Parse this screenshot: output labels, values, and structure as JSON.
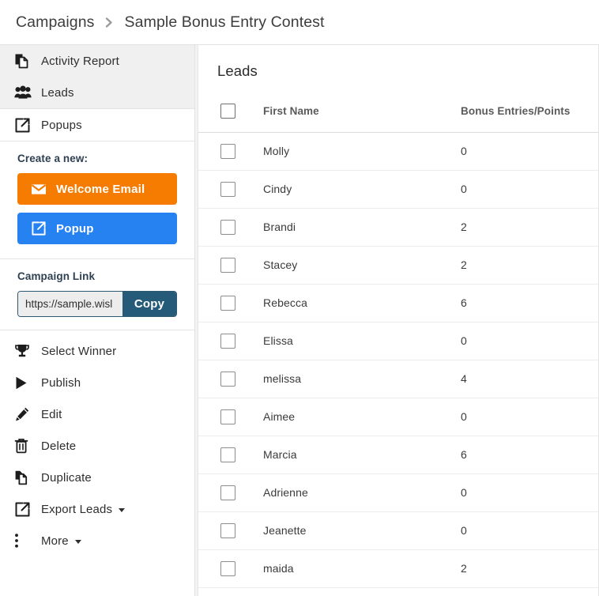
{
  "breadcrumb": {
    "root": "Campaigns",
    "separator_icon": "chevron-right-icon",
    "current": "Sample Bonus Entry Contest"
  },
  "sidebar": {
    "nav_highlighted": [
      {
        "label": "Activity Report",
        "icon": "copy-pages-icon",
        "active": true
      },
      {
        "label": "Leads",
        "icon": "users-group-icon",
        "active": true
      }
    ],
    "nav_plain": [
      {
        "label": "Popups",
        "icon": "external-link-icon",
        "active": false
      }
    ],
    "create": {
      "title": "Create a new:",
      "buttons": [
        {
          "label": "Welcome Email",
          "icon": "envelope-icon",
          "color": "#f57c00"
        },
        {
          "label": "Popup",
          "icon": "external-link-icon",
          "color": "#2682f0"
        }
      ]
    },
    "campaign_link": {
      "title": "Campaign Link",
      "input_value": "https://sample.wisl",
      "input_placeholder": "https://",
      "copy_label": "Copy",
      "copy_color": "#255a78"
    },
    "actions": [
      {
        "label": "Select Winner",
        "icon": "trophy-icon",
        "has_caret": false
      },
      {
        "label": "Publish",
        "icon": "play-triangle-icon",
        "has_caret": false
      },
      {
        "label": "Edit",
        "icon": "pencil-icon",
        "has_caret": false
      },
      {
        "label": "Delete",
        "icon": "trash-icon",
        "has_caret": false
      },
      {
        "label": "Duplicate",
        "icon": "duplicate-pages-icon",
        "has_caret": false
      },
      {
        "label": "Export Leads",
        "icon": "external-link-icon",
        "has_caret": true
      },
      {
        "label": "More",
        "icon": "kebab-menu-icon",
        "has_caret": true
      }
    ]
  },
  "main": {
    "title": "Leads",
    "table": {
      "select_all_checked": false,
      "columns": [
        "",
        "First Name",
        "Bonus Entries/Points"
      ],
      "rows": [
        {
          "checked": false,
          "first_name": "Molly",
          "points": "0"
        },
        {
          "checked": false,
          "first_name": "Cindy",
          "points": "0"
        },
        {
          "checked": false,
          "first_name": "Brandi",
          "points": "2"
        },
        {
          "checked": false,
          "first_name": "Stacey",
          "points": "2"
        },
        {
          "checked": false,
          "first_name": "Rebecca",
          "points": "6"
        },
        {
          "checked": false,
          "first_name": "Elissa",
          "points": "0"
        },
        {
          "checked": false,
          "first_name": "melissa",
          "points": "4"
        },
        {
          "checked": false,
          "first_name": "Aimee",
          "points": "0"
        },
        {
          "checked": false,
          "first_name": "Marcia",
          "points": "6"
        },
        {
          "checked": false,
          "first_name": "Adrienne",
          "points": "0"
        },
        {
          "checked": false,
          "first_name": "Jeanette",
          "points": "0"
        },
        {
          "checked": false,
          "first_name": "maida",
          "points": "2"
        }
      ]
    }
  },
  "colors": {
    "accent_orange": "#f57c00",
    "accent_blue": "#2682f0",
    "dark_teal": "#255a78",
    "nav_highlight": "#f0f0f0",
    "border": "#e2e2e2"
  }
}
